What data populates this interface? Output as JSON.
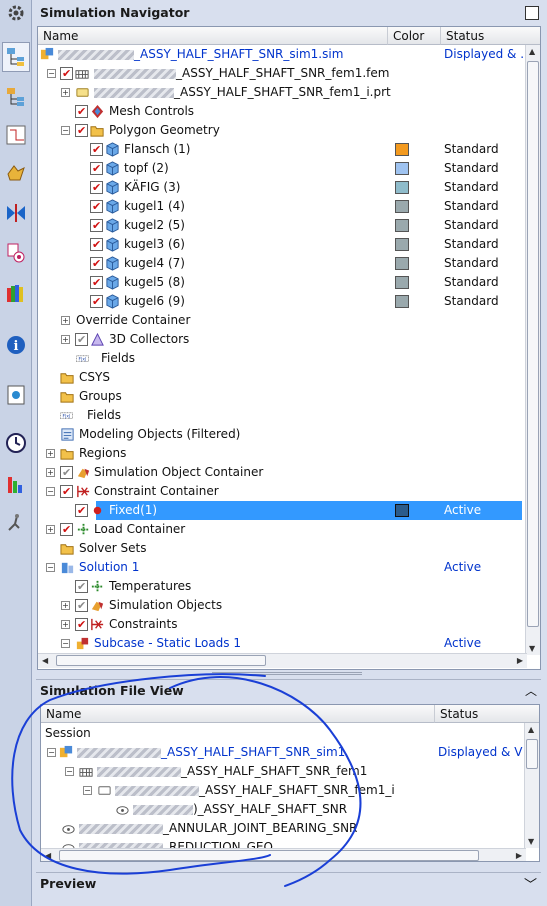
{
  "navigator": {
    "title": "Simulation Navigator",
    "columns": {
      "name": "Name",
      "color": "Color",
      "status": "Status"
    },
    "root": {
      "label": "_ASSY_HALF_SHAFT_SNR_sim1.sim",
      "status": "Displayed & ..."
    },
    "fem": {
      "label": "_ASSY_HALF_SHAFT_SNR_fem1.fem"
    },
    "prt": {
      "label": "_ASSY_HALF_SHAFT_SNR_fem1_i.prt"
    },
    "mesh_controls": "Mesh Controls",
    "polygon_geometry": "Polygon Geometry",
    "bodies": [
      {
        "label": "Flansch (1)",
        "color": "#f39a1f",
        "status": "Standard"
      },
      {
        "label": "topf (2)",
        "color": "#9fc3f0",
        "status": "Standard"
      },
      {
        "label": "KÄFIG (3)",
        "color": "#8fbccb",
        "status": "Standard"
      },
      {
        "label": "kugel1 (4)",
        "color": "#9aa9ad",
        "status": "Standard"
      },
      {
        "label": "kugel2 (5)",
        "color": "#9aa9ad",
        "status": "Standard"
      },
      {
        "label": "kugel3 (6)",
        "color": "#9aa9ad",
        "status": "Standard"
      },
      {
        "label": "kugel4 (7)",
        "color": "#9aa9ad",
        "status": "Standard"
      },
      {
        "label": "kugel5 (8)",
        "color": "#9aa9ad",
        "status": "Standard"
      },
      {
        "label": "kugel6 (9)",
        "color": "#9aa9ad",
        "status": "Standard"
      }
    ],
    "override_container": "Override Container",
    "collectors": "3D Collectors",
    "fields": "Fields",
    "csys": "CSYS",
    "groups": "Groups",
    "fields2": "Fields",
    "modeling_objects": "Modeling Objects (Filtered)",
    "regions": "Regions",
    "sim_object_container": "Simulation Object Container",
    "constraint_container": "Constraint Container",
    "fixed": {
      "label": "Fixed(1)",
      "color": "#2b5b8a",
      "status": "Active"
    },
    "load_container": "Load Container",
    "solver_sets": "Solver Sets",
    "solution": {
      "label": "Solution 1",
      "status": "Active"
    },
    "temperatures": "Temperatures",
    "simulation_objects": "Simulation Objects",
    "constraints": "Constraints",
    "subcase": {
      "label": "Subcase - Static Loads 1",
      "status": "Active"
    }
  },
  "file_view": {
    "title": "Simulation File View",
    "columns": {
      "name": "Name",
      "status": "Status"
    },
    "session": "Session",
    "sim": {
      "label": "_ASSY_HALF_SHAFT_SNR_sim1",
      "status": "Displayed & V"
    },
    "fem": "_ASSY_HALF_SHAFT_SNR_fem1",
    "fem_i": "_ASSY_HALF_SHAFT_SNR_fem1_i",
    "part": ")_ASSY_HALF_SHAFT_SNR",
    "annular": "_ANNULAR_JOINT_BEARING_SNR",
    "reduction": "_REDUCTION_GEO"
  },
  "preview": {
    "title": "Preview"
  },
  "colors": {
    "selection": "#3399ff",
    "link": "#0033cc",
    "annotation": "#1a3fd6"
  }
}
